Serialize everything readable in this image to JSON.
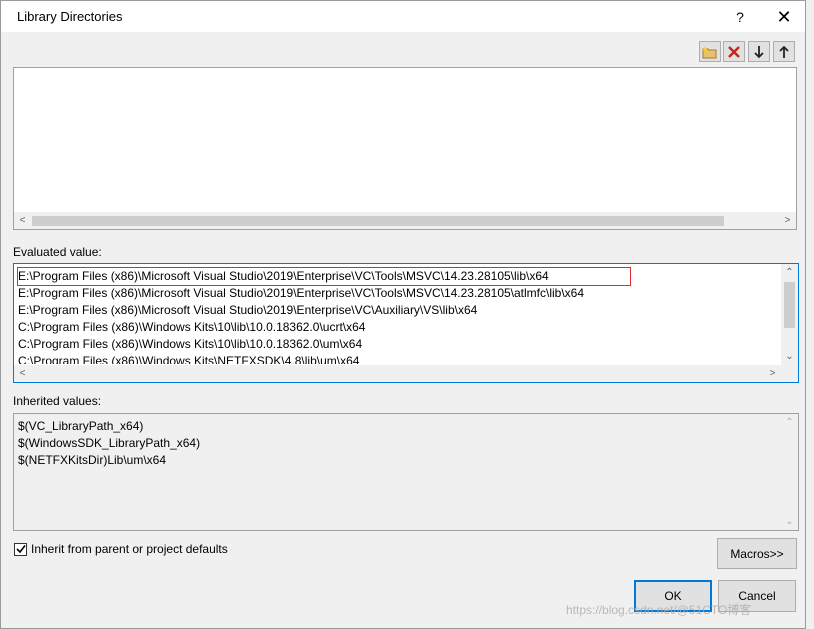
{
  "dialog": {
    "title": "Library Directories",
    "help_glyph": "?",
    "close_glyph": "✕"
  },
  "toolbar": {
    "new_line_icon": "new-folder-icon",
    "delete_icon": "delete-icon",
    "move_down_icon": "arrow-down-icon",
    "move_up_icon": "arrow-up-icon"
  },
  "evaluated": {
    "label": "Evaluated value:",
    "lines": [
      "E:\\Program Files (x86)\\Microsoft Visual Studio\\2019\\Enterprise\\VC\\Tools\\MSVC\\14.23.28105\\lib\\x64",
      "E:\\Program Files (x86)\\Microsoft Visual Studio\\2019\\Enterprise\\VC\\Tools\\MSVC\\14.23.28105\\atlmfc\\lib\\x64",
      "E:\\Program Files (x86)\\Microsoft Visual Studio\\2019\\Enterprise\\VC\\Auxiliary\\VS\\lib\\x64",
      "C:\\Program Files (x86)\\Windows Kits\\10\\lib\\10.0.18362.0\\ucrt\\x64",
      "C:\\Program Files (x86)\\Windows Kits\\10\\lib\\10.0.18362.0\\um\\x64",
      "C:\\Program Files (x86)\\Windows Kits\\NETFXSDK\\4.8\\lib\\um\\x64"
    ]
  },
  "inherited": {
    "label": "Inherited values:",
    "lines": [
      "$(VC_LibraryPath_x64)",
      "$(WindowsSDK_LibraryPath_x64)",
      "$(NETFXKitsDir)Lib\\um\\x64"
    ]
  },
  "options": {
    "inherit_label": "Inherit from parent or project defaults",
    "inherit_checked": true
  },
  "buttons": {
    "macros": "Macros>>",
    "ok": "OK",
    "cancel": "Cancel"
  },
  "watermark": "https://blog.csdn.net/@51CTO博客",
  "colors": {
    "accent": "#0078d7",
    "highlight_border": "#e0282d"
  }
}
